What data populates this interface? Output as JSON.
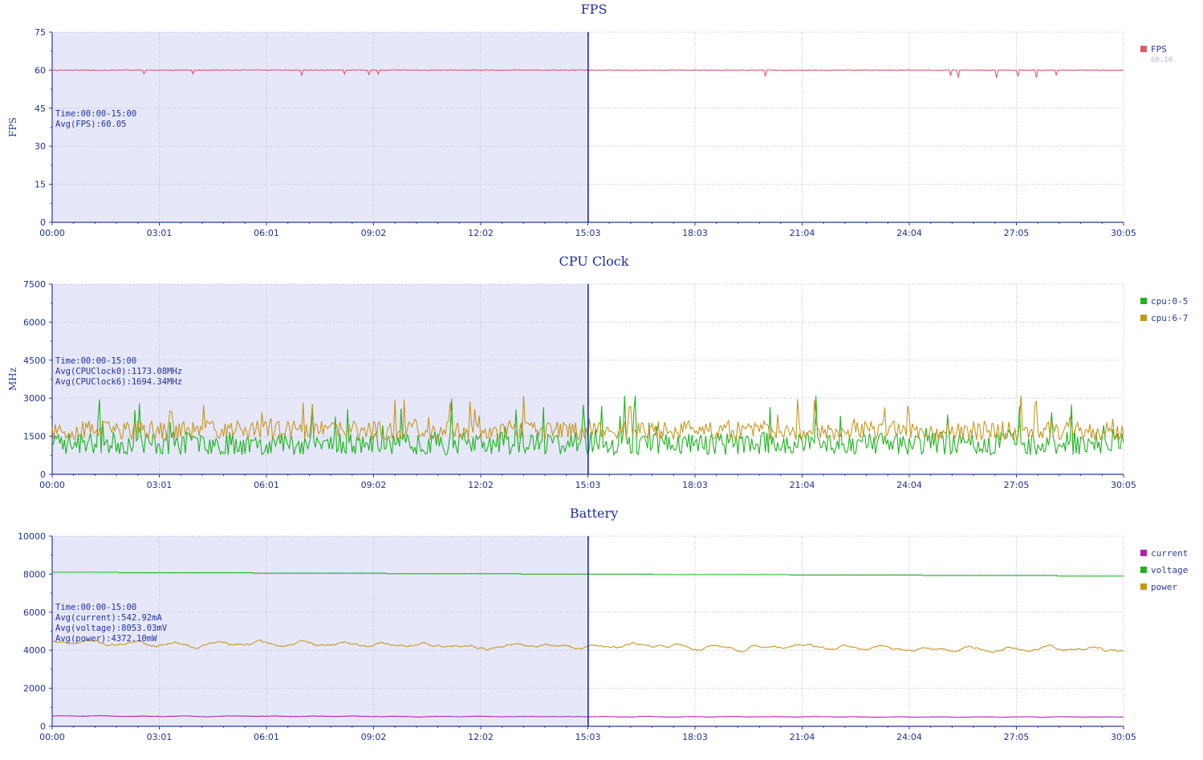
{
  "chart_data": [
    {
      "type": "line",
      "title": "FPS",
      "ylabel": "FPS",
      "ylim": [
        0,
        75
      ],
      "yticks": [
        0,
        15,
        30,
        45,
        60,
        75
      ],
      "xtick_labels": [
        "00:00",
        "03:01",
        "06:01",
        "09:02",
        "12:02",
        "15:03",
        "18:03",
        "21:04",
        "24:04",
        "27:05",
        "30:05"
      ],
      "xlim": [
        "00:00",
        "30:05"
      ],
      "grid": true,
      "legend_position": "top-right",
      "selection": {
        "start": "00:00",
        "end": "15:03"
      },
      "annotation": [
        "Time:00:00-15:00",
        "Avg(FPS):60.05"
      ],
      "series": [
        {
          "name": "FPS",
          "sublabel": "60.10",
          "color": "#e05a6e",
          "base": 60,
          "noise": 0.3,
          "spike_down": 1.2,
          "spike_rate": 0.02,
          "seed": 11
        }
      ]
    },
    {
      "type": "line",
      "title": "CPU Clock",
      "ylabel": "MHz",
      "ylim": [
        0,
        7500
      ],
      "yticks": [
        0,
        1500,
        3000,
        4500,
        6000,
        7500
      ],
      "xtick_labels": [
        "00:00",
        "03:01",
        "06:01",
        "09:02",
        "12:02",
        "15:03",
        "18:03",
        "21:04",
        "24:04",
        "27:05",
        "30:05"
      ],
      "xlim": [
        "00:00",
        "30:05"
      ],
      "grid": true,
      "legend_position": "top-right",
      "selection": {
        "start": "00:00",
        "end": "15:03"
      },
      "annotation": [
        "Time:00:00-15:00",
        "Avg(CPUClock0):1173.08MHz",
        "Avg(CPUClock6):1694.34MHz"
      ],
      "series": [
        {
          "name": "cpu:0-5",
          "color": "#1db41d",
          "base": 1173,
          "spread": 650,
          "min": 400,
          "max": 3100,
          "seed": 23,
          "mode": "jagged"
        },
        {
          "name": "cpu:6-7",
          "color": "#c8961e",
          "base": 1694,
          "spread": 550,
          "min": 600,
          "max": 3100,
          "seed": 37,
          "mode": "jagged"
        }
      ]
    },
    {
      "type": "line",
      "title": "Battery",
      "ylabel": "",
      "ylim": [
        0,
        10000
      ],
      "yticks": [
        0,
        2000,
        4000,
        6000,
        8000,
        10000
      ],
      "xtick_labels": [
        "00:00",
        "03:01",
        "06:01",
        "09:02",
        "12:02",
        "15:03",
        "18:03",
        "21:04",
        "24:04",
        "27:05",
        "30:05"
      ],
      "xlim": [
        "00:00",
        "30:05"
      ],
      "grid": true,
      "legend_position": "top-right",
      "selection": {
        "start": "00:00",
        "end": "15:03"
      },
      "annotation": [
        "Time:00:00-15:00",
        "Avg(current):542.92mA",
        "Avg(voltage):8053.03mV",
        "Avg(power):4372.10mW"
      ],
      "series": [
        {
          "name": "current",
          "color": "#b41eb4",
          "base": 540,
          "drift": -60,
          "spread": 40,
          "seed": 51,
          "mode": "smooth"
        },
        {
          "name": "voltage",
          "color": "#1db41d",
          "base": 8100,
          "drift": -200,
          "spread": 0,
          "seed": 61,
          "mode": "step"
        },
        {
          "name": "power",
          "color": "#c8961e",
          "base": 4400,
          "drift": -400,
          "spread": 350,
          "seed": 71,
          "mode": "smooth"
        }
      ]
    }
  ]
}
